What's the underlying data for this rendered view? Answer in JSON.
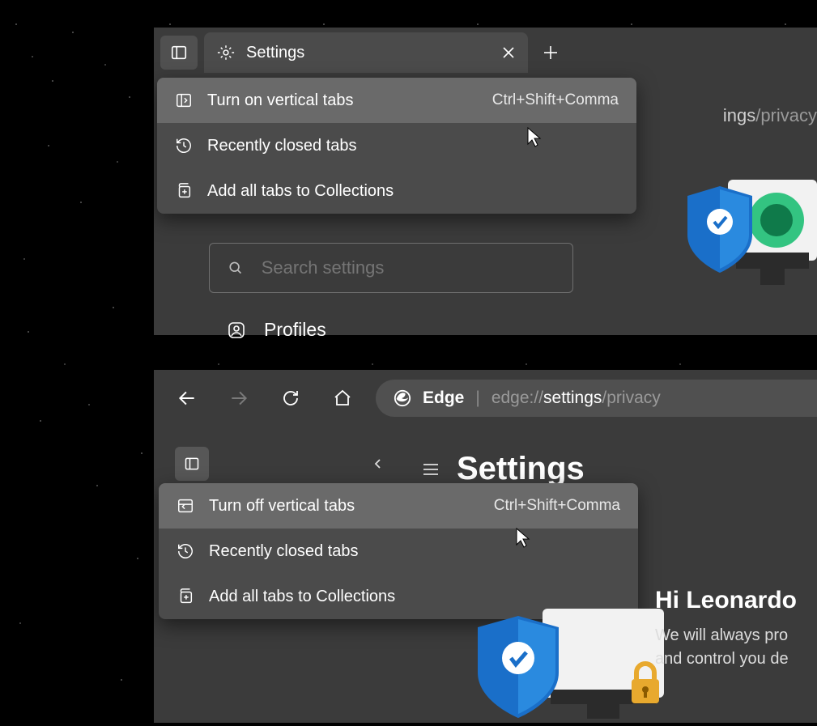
{
  "top": {
    "tab": {
      "title": "Settings"
    },
    "menu": {
      "item0": {
        "label": "Turn on vertical tabs",
        "shortcut": "Ctrl+Shift+Comma"
      },
      "item1": {
        "label": "Recently closed tabs"
      },
      "item2": {
        "label": "Add all tabs to Collections"
      }
    },
    "addr_fragment": {
      "bold": "ings",
      "dim": "/privacy"
    },
    "search": {
      "placeholder": "Search settings"
    },
    "nav": {
      "profiles": "Profiles"
    }
  },
  "bottom": {
    "addr": {
      "brand": "Edge",
      "proto": "edge://",
      "bold": "settings",
      "rest": "/privacy"
    },
    "page": {
      "title": "Settings"
    },
    "menu": {
      "item0": {
        "label": "Turn off vertical tabs",
        "shortcut": "Ctrl+Shift+Comma"
      },
      "item1": {
        "label": "Recently closed tabs"
      },
      "item2": {
        "label": "Add all tabs to Collections"
      }
    },
    "greet": {
      "heading": "Hi Leonardo",
      "line1": "We will always pro",
      "line2": "and control you de"
    }
  }
}
